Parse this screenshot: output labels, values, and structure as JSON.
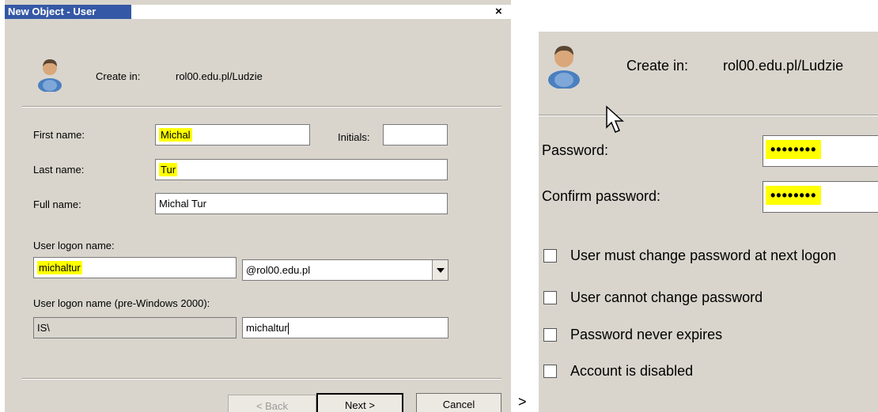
{
  "dialog": {
    "title": "New Object - User",
    "close": "×",
    "create_in_label": "Create in:",
    "create_in_value": "rol00.edu.pl/Ludzie",
    "first_name_label": "First name:",
    "first_name_value": "Michal",
    "initials_label": "Initials:",
    "initials_value": "",
    "last_name_label": "Last name:",
    "last_name_value": "Tur",
    "full_name_label": "Full name:",
    "full_name_value": "Michal Tur",
    "logon_name_label": "User logon name:",
    "logon_name_value": "michaltur",
    "domain_value": "@rol00.edu.pl",
    "pre2000_label": "User logon name (pre-Windows 2000):",
    "pre2000_domain": "IS\\",
    "pre2000_value": "michaltur",
    "buttons": {
      "back": "< Back",
      "next": "Next >",
      "cancel": "Cancel"
    }
  },
  "between_arrow": ">",
  "zoom_panel": {
    "create_in_label": "Create in:",
    "create_in_value": "rol00.edu.pl/Ludzie",
    "password_label": "Password:",
    "password_value": "••••••••",
    "confirm_label": "Confirm password:",
    "confirm_value": "••••••••",
    "checkboxes": [
      {
        "label": "User must change password at next logon",
        "checked": false
      },
      {
        "label": "User cannot change password",
        "checked": false
      },
      {
        "label": "Password never expires",
        "checked": false
      },
      {
        "label": "Account is disabled",
        "checked": false
      }
    ]
  },
  "colors": {
    "highlight": "#ffff00",
    "titlebar": "#3558a6",
    "dialog_bg": "#d9d5cd"
  },
  "icons": [
    "user-icon",
    "mouse-cursor-icon",
    "dropdown-arrow-icon"
  ]
}
